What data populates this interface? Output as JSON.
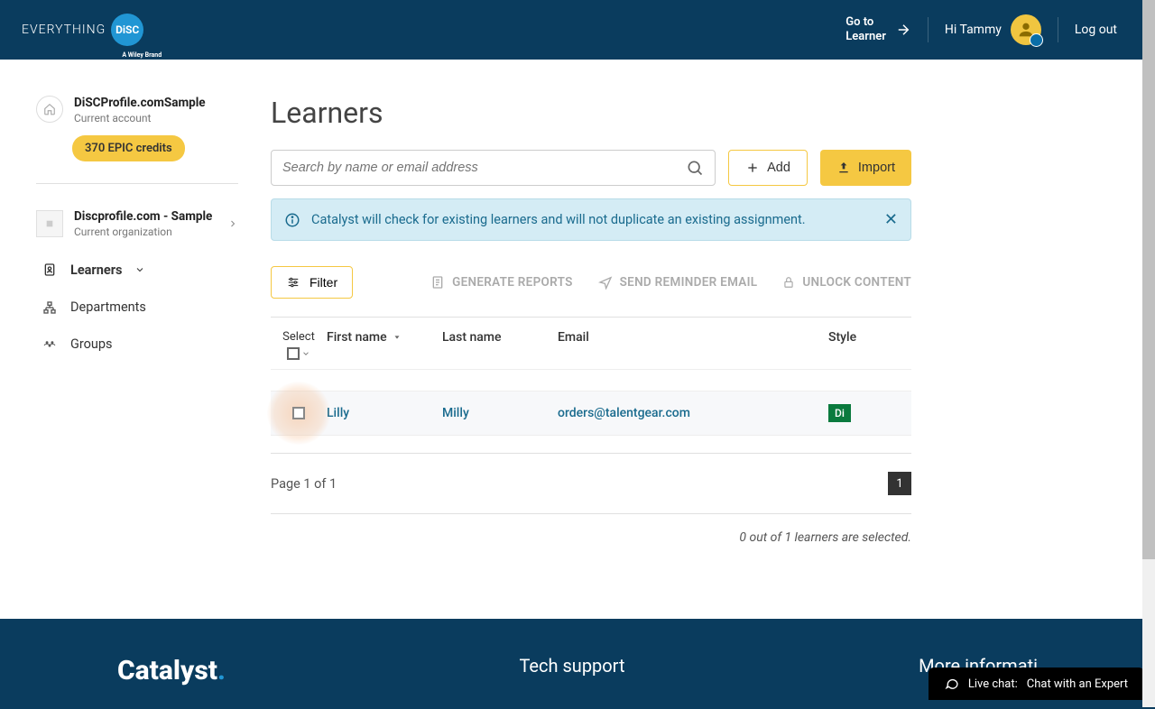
{
  "header": {
    "logo_text": "EVERYTHING",
    "logo_disc": "DiSC",
    "logo_sub": "A Wiley Brand",
    "go_to_learner": "Go to\nLearner",
    "greeting": "Hi Tammy",
    "logout": "Log out"
  },
  "sidebar": {
    "account_title": "DiSCProfile.comSample",
    "account_sub": "Current account",
    "credits": "370 EPIC credits",
    "org_title": "Discprofile.com - Sample",
    "org_sub": "Current organization",
    "nav": {
      "learners": "Learners",
      "departments": "Departments",
      "groups": "Groups"
    }
  },
  "main": {
    "title": "Learners",
    "search_placeholder": "Search by name or email address",
    "add": "Add",
    "import": "Import",
    "alert": "Catalyst will check for existing learners and will not duplicate an existing assignment.",
    "filter": "Filter",
    "generate_reports": "GENERATE REPORTS",
    "send_reminder": "SEND REMINDER EMAIL",
    "unlock_content": "UNLOCK CONTENT",
    "columns": {
      "select": "Select",
      "first_name": "First name",
      "last_name": "Last name",
      "email": "Email",
      "style": "Style"
    },
    "rows": [
      {
        "first_name": "Lilly",
        "last_name": "Milly",
        "email": "orders@talentgear.com",
        "style": "Di"
      }
    ],
    "page_text": "Page 1 of 1",
    "page_num": "1",
    "selection_status": "0 out of 1 learners are selected."
  },
  "footer": {
    "logo": "Catalyst",
    "tech_support": "Tech support",
    "more_info": "More informati"
  },
  "chat": {
    "label": "Live chat:",
    "text": "Chat with an Expert"
  }
}
